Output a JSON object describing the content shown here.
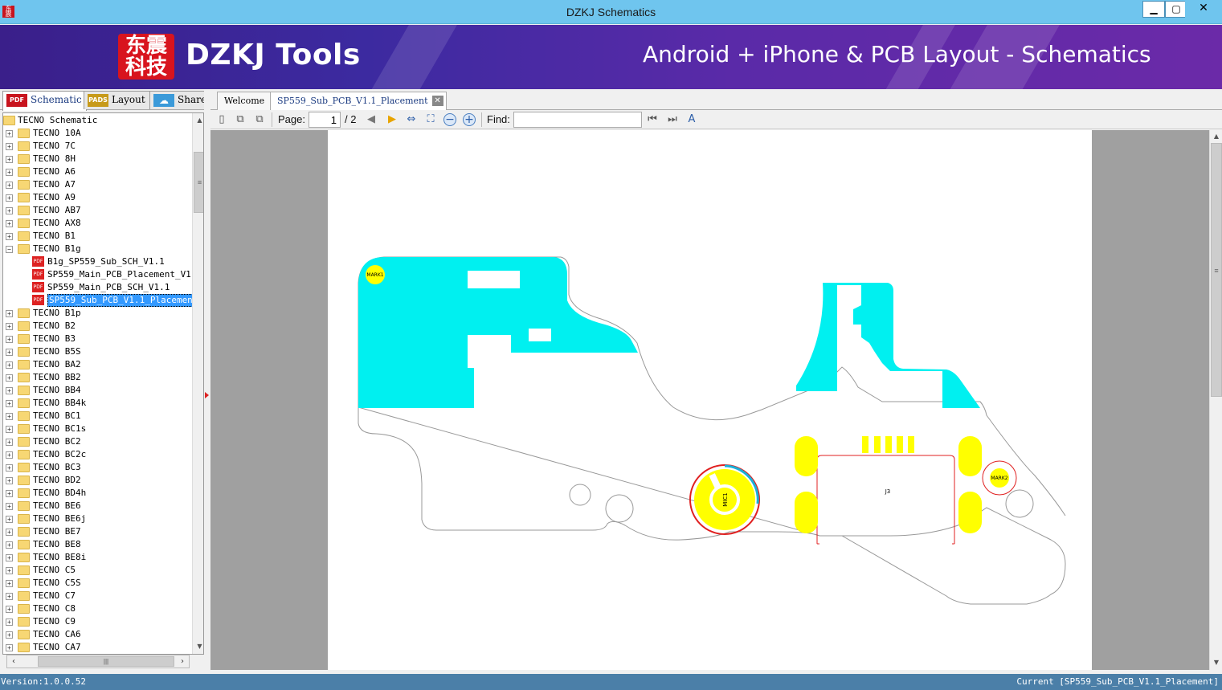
{
  "window": {
    "title": "DZKJ Schematics",
    "minimize": "▁",
    "maximize": "▢",
    "close": "✕",
    "app_icon": "东震"
  },
  "banner": {
    "logo_mark": "东震\n科技",
    "logo_text": "DZKJ Tools",
    "slogan": "Android + iPhone & PCB Layout - Schematics"
  },
  "sidebar_tabs": [
    {
      "label": "Schematic",
      "icon": "PDF",
      "icon_color": "#c8141e"
    },
    {
      "label": "Layout",
      "icon": "PADS",
      "icon_color": "#c79a1a"
    },
    {
      "label": "Share",
      "icon": "cloud-icon",
      "icon_color": "#3b9ad9"
    }
  ],
  "tree": {
    "root": "TECNO Schematic",
    "items": [
      "TECNO 10A",
      "TECNO 7C",
      "TECNO 8H",
      "TECNO A6",
      "TECNO A7",
      "TECNO A9",
      "TECNO AB7",
      "TECNO AX8",
      "TECNO B1",
      "TECNO B1g"
    ],
    "children": [
      "B1g_SP559_Sub_SCH_V1.1",
      "SP559_Main_PCB_Placement_V1.1",
      "SP559_Main_PCB_SCH_V1.1",
      "SP559_Sub_PCB_V1.1_Placement"
    ],
    "items_after": [
      "TECNO B1p",
      "TECNO B2",
      "TECNO B3",
      "TECNO B5S",
      "TECNO BA2",
      "TECNO BB2",
      "TECNO BB4",
      "TECNO BB4k",
      "TECNO BC1",
      "TECNO BC1s",
      "TECNO BC2",
      "TECNO BC2c",
      "TECNO BC3",
      "TECNO BD2",
      "TECNO BD4h",
      "TECNO BE6",
      "TECNO BE6j",
      "TECNO BE7",
      "TECNO BE8",
      "TECNO BE8i",
      "TECNO C5",
      "TECNO C5S",
      "TECNO C7",
      "TECNO C8",
      "TECNO C9",
      "TECNO CA6",
      "TECNO CA7"
    ],
    "expand_collapsed": "+",
    "expand_open": "−"
  },
  "doc_tabs": [
    {
      "label": "Welcome"
    },
    {
      "label": "SP559_Sub_PCB_V1.1_Placement",
      "close": "✕"
    }
  ],
  "toolbar": {
    "page_label": "Page:",
    "page_value": "1",
    "page_total": "/ 2",
    "find_label": "Find:",
    "find_value": ""
  },
  "pcb": {
    "labels": {
      "mark1": "MARK1",
      "mark2": "MARK2",
      "mic": "MIC1",
      "j3": "J3"
    },
    "colors": {
      "copper": "#00f0f0",
      "pad": "#ffff00",
      "outline": "#999999",
      "silk": "#e02020",
      "mic_ring": "#1ab0d8"
    }
  },
  "status": {
    "version": "Version:1.0.0.52",
    "current": "Current [SP559_Sub_PCB_V1.1_Placement]"
  }
}
